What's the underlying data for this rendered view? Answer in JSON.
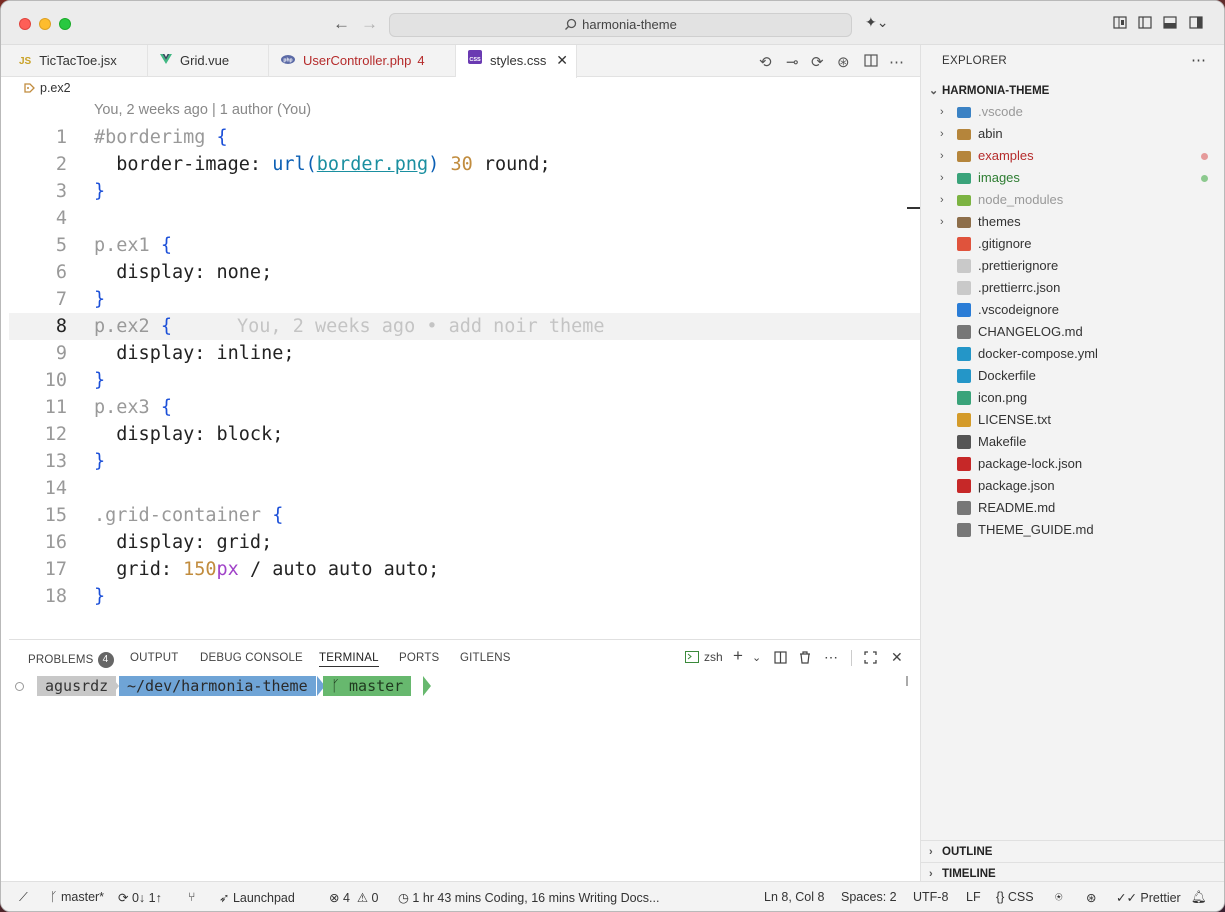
{
  "titlebar": {
    "search_text": "harmonia-theme"
  },
  "tabs": [
    {
      "label": "TicTacToe.jsx",
      "icon": "JS",
      "color": "#333333",
      "icon_color": "#c9a227"
    },
    {
      "label": "Grid.vue",
      "icon": "vue-icon",
      "color": "#333333"
    },
    {
      "label": "UserController.php",
      "badge": "4",
      "icon": "php-icon",
      "color": "#b52b2b"
    },
    {
      "label": "styles.css",
      "icon": "css-icon",
      "color": "#222222",
      "active": true
    }
  ],
  "breadcrumb": {
    "symbol": "p.ex2"
  },
  "editor": {
    "codelens": "You, 2 weeks ago | 1 author (You)",
    "blame": "You, 2 weeks ago • add noir theme",
    "current_line": 8,
    "line_numbers": [
      "1",
      "2",
      "3",
      "4",
      "5",
      "6",
      "7",
      "8",
      "9",
      "10",
      "11",
      "12",
      "13",
      "14",
      "15",
      "16",
      "17",
      "18"
    ],
    "code": {
      "l1_sel": "#borderimg",
      "l1_brace": "{",
      "l2_prop": "  border-image: ",
      "l2_fn": "url(",
      "l2_url": "border.png",
      "l2_fn_close": ")",
      "l2_num": "30",
      "l2_rest": " round;",
      "close": "}",
      "l5_sel": "p.ex1",
      "l6": "  display: none;",
      "l8_sel": "p.ex2",
      "l9": "  display: inline;",
      "l11_sel": "p.ex3",
      "l12": "  display: block;",
      "l15_sel": ".grid-container",
      "l16": "  display: grid;",
      "l17_prop": "  grid: ",
      "l17_num": "150",
      "l17_unit": "px",
      "l17_rest": " / auto auto auto;",
      "open": "{"
    }
  },
  "panel": {
    "tabs": {
      "problems": "PROBLEMS",
      "problems_count": "4",
      "output": "OUTPUT",
      "debug": "DEBUG CONSOLE",
      "terminal": "TERMINAL",
      "ports": "PORTS",
      "gitlens": "GITLENS"
    },
    "shell": "zsh",
    "prompt": {
      "user": "agusrdz",
      "path": "~/dev/harmonia-theme",
      "branch": "ᚴ master"
    }
  },
  "explorer": {
    "title": "EXPLORER",
    "root": "HARMONIA-THEME",
    "items": [
      {
        "label": ".vscode",
        "folder": true,
        "color": "#999999",
        "icon_color": "#3b82c4"
      },
      {
        "label": "abin",
        "folder": true,
        "color": "#333333",
        "icon_color": "#b5853b"
      },
      {
        "label": "examples",
        "folder": true,
        "color": "#b52b2b",
        "icon_color": "#b5853b",
        "mark": "#e59a9a"
      },
      {
        "label": "images",
        "folder": true,
        "color": "#2e7d32",
        "icon_color": "#3aa37a",
        "mark": "#8cc98e"
      },
      {
        "label": "node_modules",
        "folder": true,
        "color": "#999999",
        "icon_color": "#7cb342"
      },
      {
        "label": "themes",
        "folder": true,
        "color": "#333333",
        "icon_color": "#8d6e4a"
      },
      {
        "label": ".gitignore",
        "color": "#333333",
        "icon_color": "#e0533c"
      },
      {
        "label": ".prettierignore",
        "color": "#333333",
        "icon_color": "#c9c9c9"
      },
      {
        "label": ".prettierrc.json",
        "color": "#333333",
        "icon_color": "#c9c9c9"
      },
      {
        "label": ".vscodeignore",
        "color": "#333333",
        "icon_color": "#2a7cd6"
      },
      {
        "label": "CHANGELOG.md",
        "color": "#333333",
        "icon_color": "#777777"
      },
      {
        "label": "docker-compose.yml",
        "color": "#333333",
        "icon_color": "#2496c8"
      },
      {
        "label": "Dockerfile",
        "color": "#333333",
        "icon_color": "#2496c8"
      },
      {
        "label": "icon.png",
        "color": "#333333",
        "icon_color": "#3aa37a"
      },
      {
        "label": "LICENSE.txt",
        "color": "#333333",
        "icon_color": "#d49b2a"
      },
      {
        "label": "Makefile",
        "color": "#333333",
        "icon_color": "#555555"
      },
      {
        "label": "package-lock.json",
        "color": "#333333",
        "icon_color": "#c62828"
      },
      {
        "label": "package.json",
        "color": "#333333",
        "icon_color": "#c62828"
      },
      {
        "label": "README.md",
        "color": "#333333",
        "icon_color": "#777777"
      },
      {
        "label": "THEME_GUIDE.md",
        "color": "#333333",
        "icon_color": "#777777"
      }
    ],
    "outline": "OUTLINE",
    "timeline": "TIMELINE"
  },
  "statusbar": {
    "branch": "master*",
    "sync": "0↓ 1↑",
    "launchpad": "Launchpad",
    "errors": "4",
    "warnings": "0",
    "wakatime": "1 hr 43 mins Coding, 16 mins Writing Docs...",
    "position": "Ln 8, Col 8",
    "spaces": "Spaces: 2",
    "encoding": "UTF-8",
    "eol": "LF",
    "language": "CSS",
    "prettier": "Prettier"
  }
}
